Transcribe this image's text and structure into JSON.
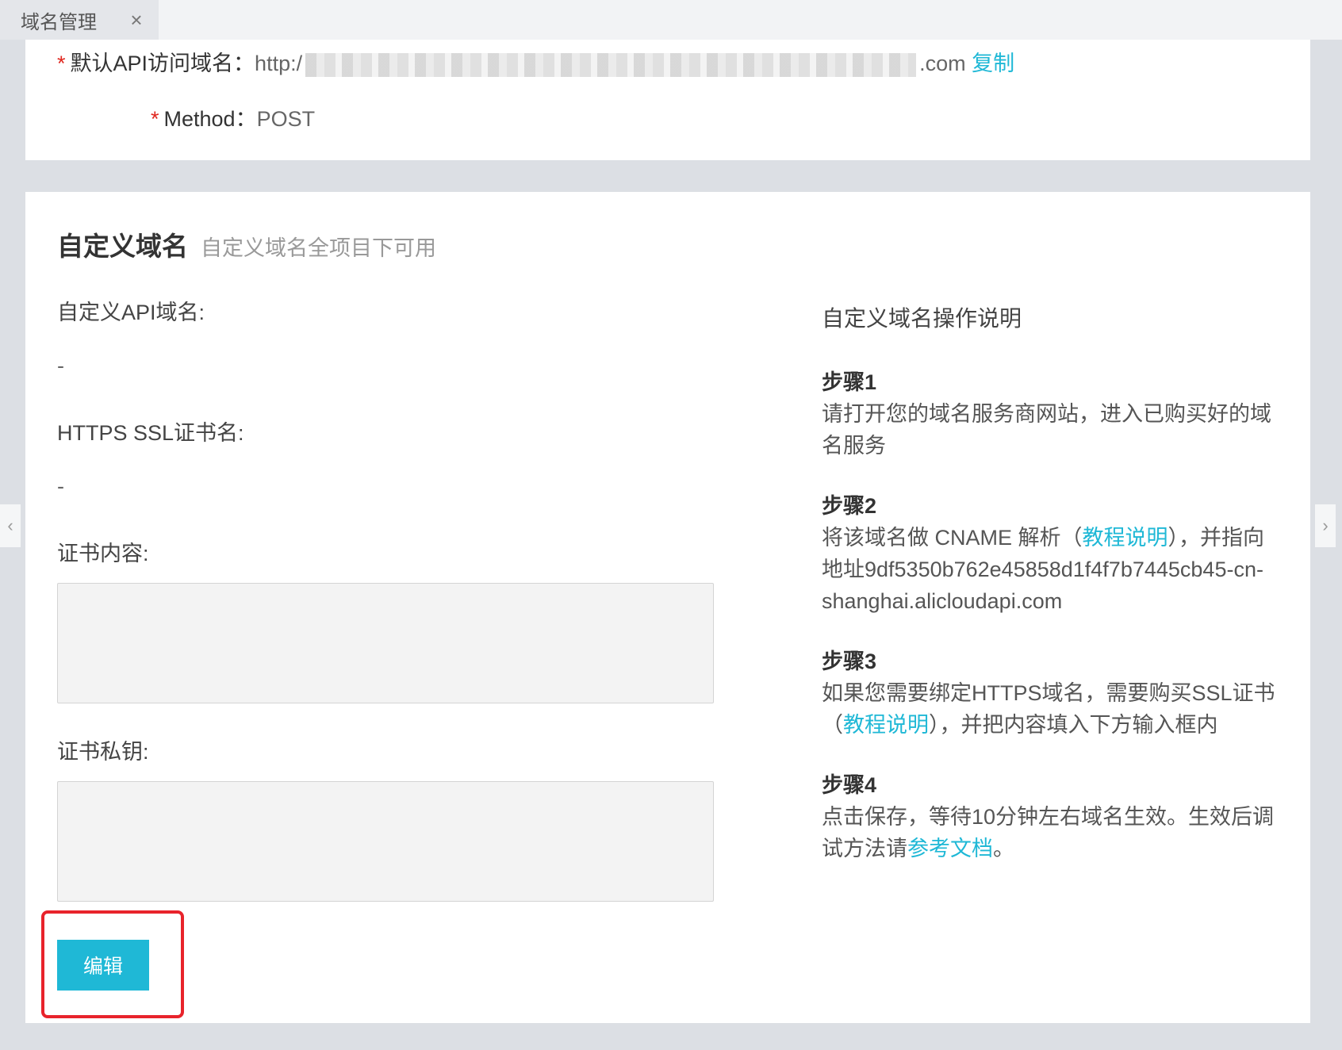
{
  "tab": {
    "label": "域名管理",
    "close_symbol": "×"
  },
  "default_domain": {
    "label": "默认API访问域名：",
    "value_prefix": "http:/",
    "value_suffix": ".com",
    "copy_label": "复制"
  },
  "method": {
    "label": "Method：",
    "value": "POST"
  },
  "custom_domain": {
    "title": "自定义域名",
    "subtitle": "自定义域名全项目下可用",
    "api_domain_label": "自定义API域名:",
    "api_domain_value": "-",
    "ssl_name_label": "HTTPS SSL证书名:",
    "ssl_name_value": "-",
    "cert_content_label": "证书内容:",
    "cert_key_label": "证书私钥:",
    "edit_label": "编辑"
  },
  "help": {
    "title": "自定义域名操作说明",
    "step1": {
      "title": "步骤1",
      "text": "请打开您的域名服务商网站，进入已购买好的域名服务"
    },
    "step2": {
      "title": "步骤2",
      "text_before": "将该域名做 CNAME 解析（",
      "link": "教程说明",
      "text_after": "），并指向地址9df5350b762e45858d1f4f7b7445cb45-cn-shanghai.alicloudapi.com"
    },
    "step3": {
      "title": "步骤3",
      "text_before": "如果您需要绑定HTTPS域名，需要购买SSL证书（",
      "link": "教程说明",
      "text_after": "），并把内容填入下方输入框内"
    },
    "step4": {
      "title": "步骤4",
      "text_before": "点击保存，等待10分钟左右域名生效。生效后调试方法请",
      "link": "参考文档",
      "text_after": "。"
    }
  },
  "nav": {
    "left_symbol": "‹",
    "right_symbol": "›"
  },
  "colors": {
    "accent": "#1fb8d6",
    "required": "#e0271f",
    "highlight": "#e8232b"
  }
}
